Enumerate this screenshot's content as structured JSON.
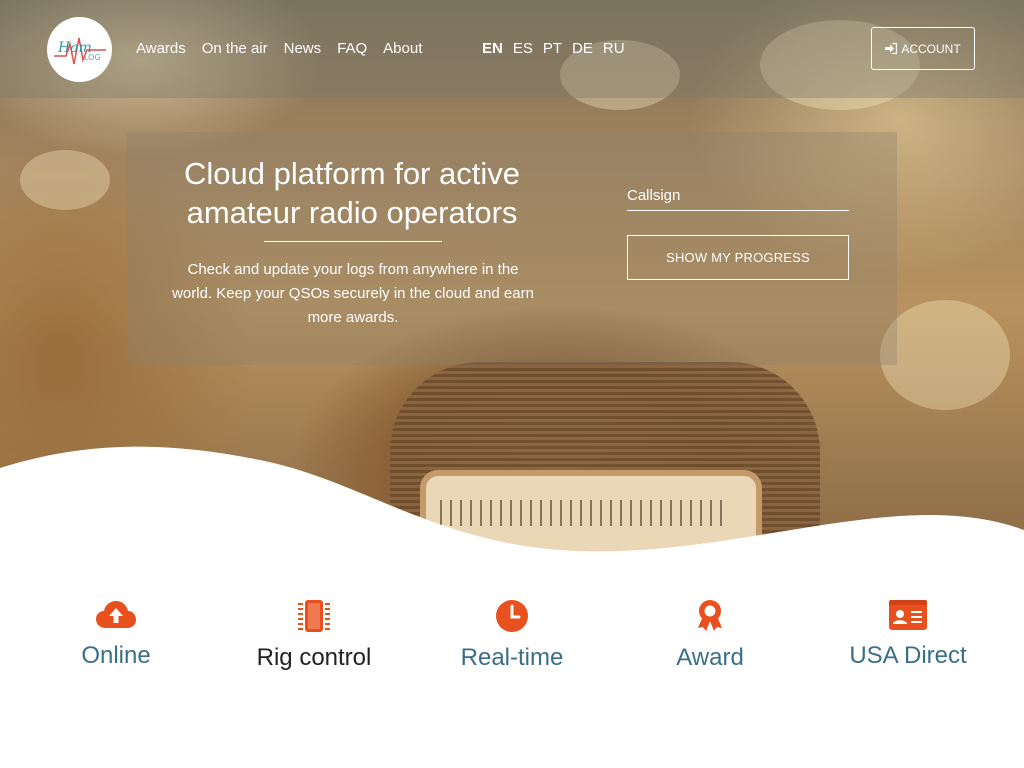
{
  "brand": {
    "logo_text": "Ham Log"
  },
  "nav": {
    "items": [
      {
        "label": "Awards"
      },
      {
        "label": "On the air"
      },
      {
        "label": "News"
      },
      {
        "label": "FAQ"
      },
      {
        "label": "About"
      }
    ],
    "languages": [
      {
        "label": "EN",
        "active": true
      },
      {
        "label": "ES"
      },
      {
        "label": "PT"
      },
      {
        "label": "DE"
      },
      {
        "label": "RU"
      }
    ],
    "account_label": "ACCOUNT",
    "account_icon": "sign-in-icon"
  },
  "hero": {
    "title": "Cloud platform for active amateur radio operators",
    "description": "Check and update your logs from anywhere in the world. Keep your QSOs securely in the cloud and earn more awards.",
    "callsign_placeholder": "Callsign",
    "progress_button": "SHOW MY PROGRESS"
  },
  "colors": {
    "accent": "#e8501e",
    "feature_text": "#3a6f87"
  },
  "features": [
    {
      "icon": "cloud-upload-icon",
      "title": "Online"
    },
    {
      "icon": "chip-icon",
      "title": "Rig control"
    },
    {
      "icon": "clock-icon",
      "title": "Real-time"
    },
    {
      "icon": "award-icon",
      "title": "Award"
    },
    {
      "icon": "id-card-icon",
      "title": "USA Direct"
    }
  ]
}
